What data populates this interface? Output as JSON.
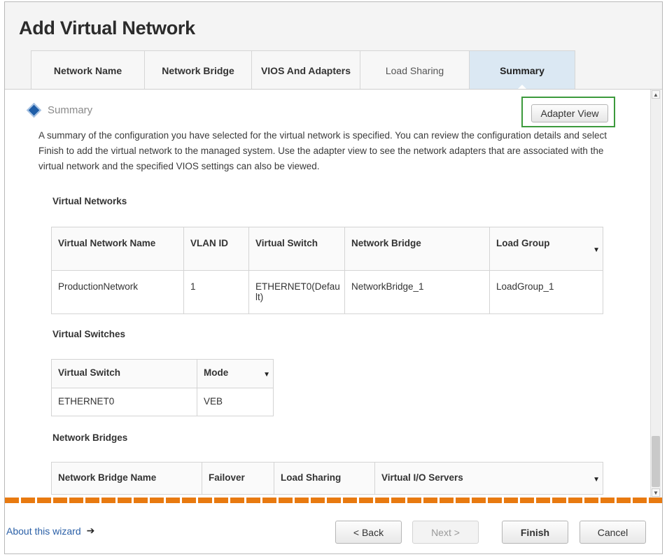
{
  "wizard": {
    "title": "Add Virtual Network"
  },
  "tabs": [
    {
      "label": "Network Name",
      "state": "completed"
    },
    {
      "label": "Network Bridge",
      "state": "completed"
    },
    {
      "label": "VIOS And Adapters",
      "state": "completed"
    },
    {
      "label": "Load Sharing",
      "state": "optional"
    },
    {
      "label": "Summary",
      "state": "active"
    }
  ],
  "summary": {
    "section_title": "Summary",
    "adapter_view_label": "Adapter View",
    "description": "A summary of the configuration you have selected for the virtual network is specified. You can review the configuration details and select Finish to add the virtual network to the managed system. Use the adapter view to see the network adapters that are associated with the virtual network and the specified VIOS settings can also be viewed."
  },
  "virtual_networks": {
    "heading": "Virtual Networks",
    "columns": [
      "Virtual Network Name",
      "VLAN ID",
      "Virtual Switch",
      "Network Bridge",
      "Load Group"
    ],
    "rows": [
      [
        "ProductionNetwork",
        "1",
        "ETHERNET0(Default)",
        "NetworkBridge_1",
        "LoadGroup_1"
      ]
    ]
  },
  "virtual_switches": {
    "heading": "Virtual Switches",
    "columns": [
      "Virtual Switch",
      "Mode"
    ],
    "rows": [
      [
        "ETHERNET0",
        "VEB"
      ]
    ]
  },
  "network_bridges": {
    "heading": "Network Bridges",
    "columns": [
      "Network Bridge Name",
      "Failover",
      "Load Sharing",
      "Virtual I/O Servers"
    ]
  },
  "footer": {
    "about_label": "About this wizard",
    "back_label": "< Back",
    "next_label": "Next >",
    "finish_label": "Finish",
    "cancel_label": "Cancel"
  },
  "icons": {
    "section": "diamond-info-icon",
    "about": "arrow-right-icon",
    "sort": "caret-down-icon"
  },
  "colors": {
    "accent_orange": "#e87a10",
    "link_blue": "#2b60a7",
    "active_tab": "#dbe8f3",
    "highlight_green": "#3c9a3c"
  }
}
